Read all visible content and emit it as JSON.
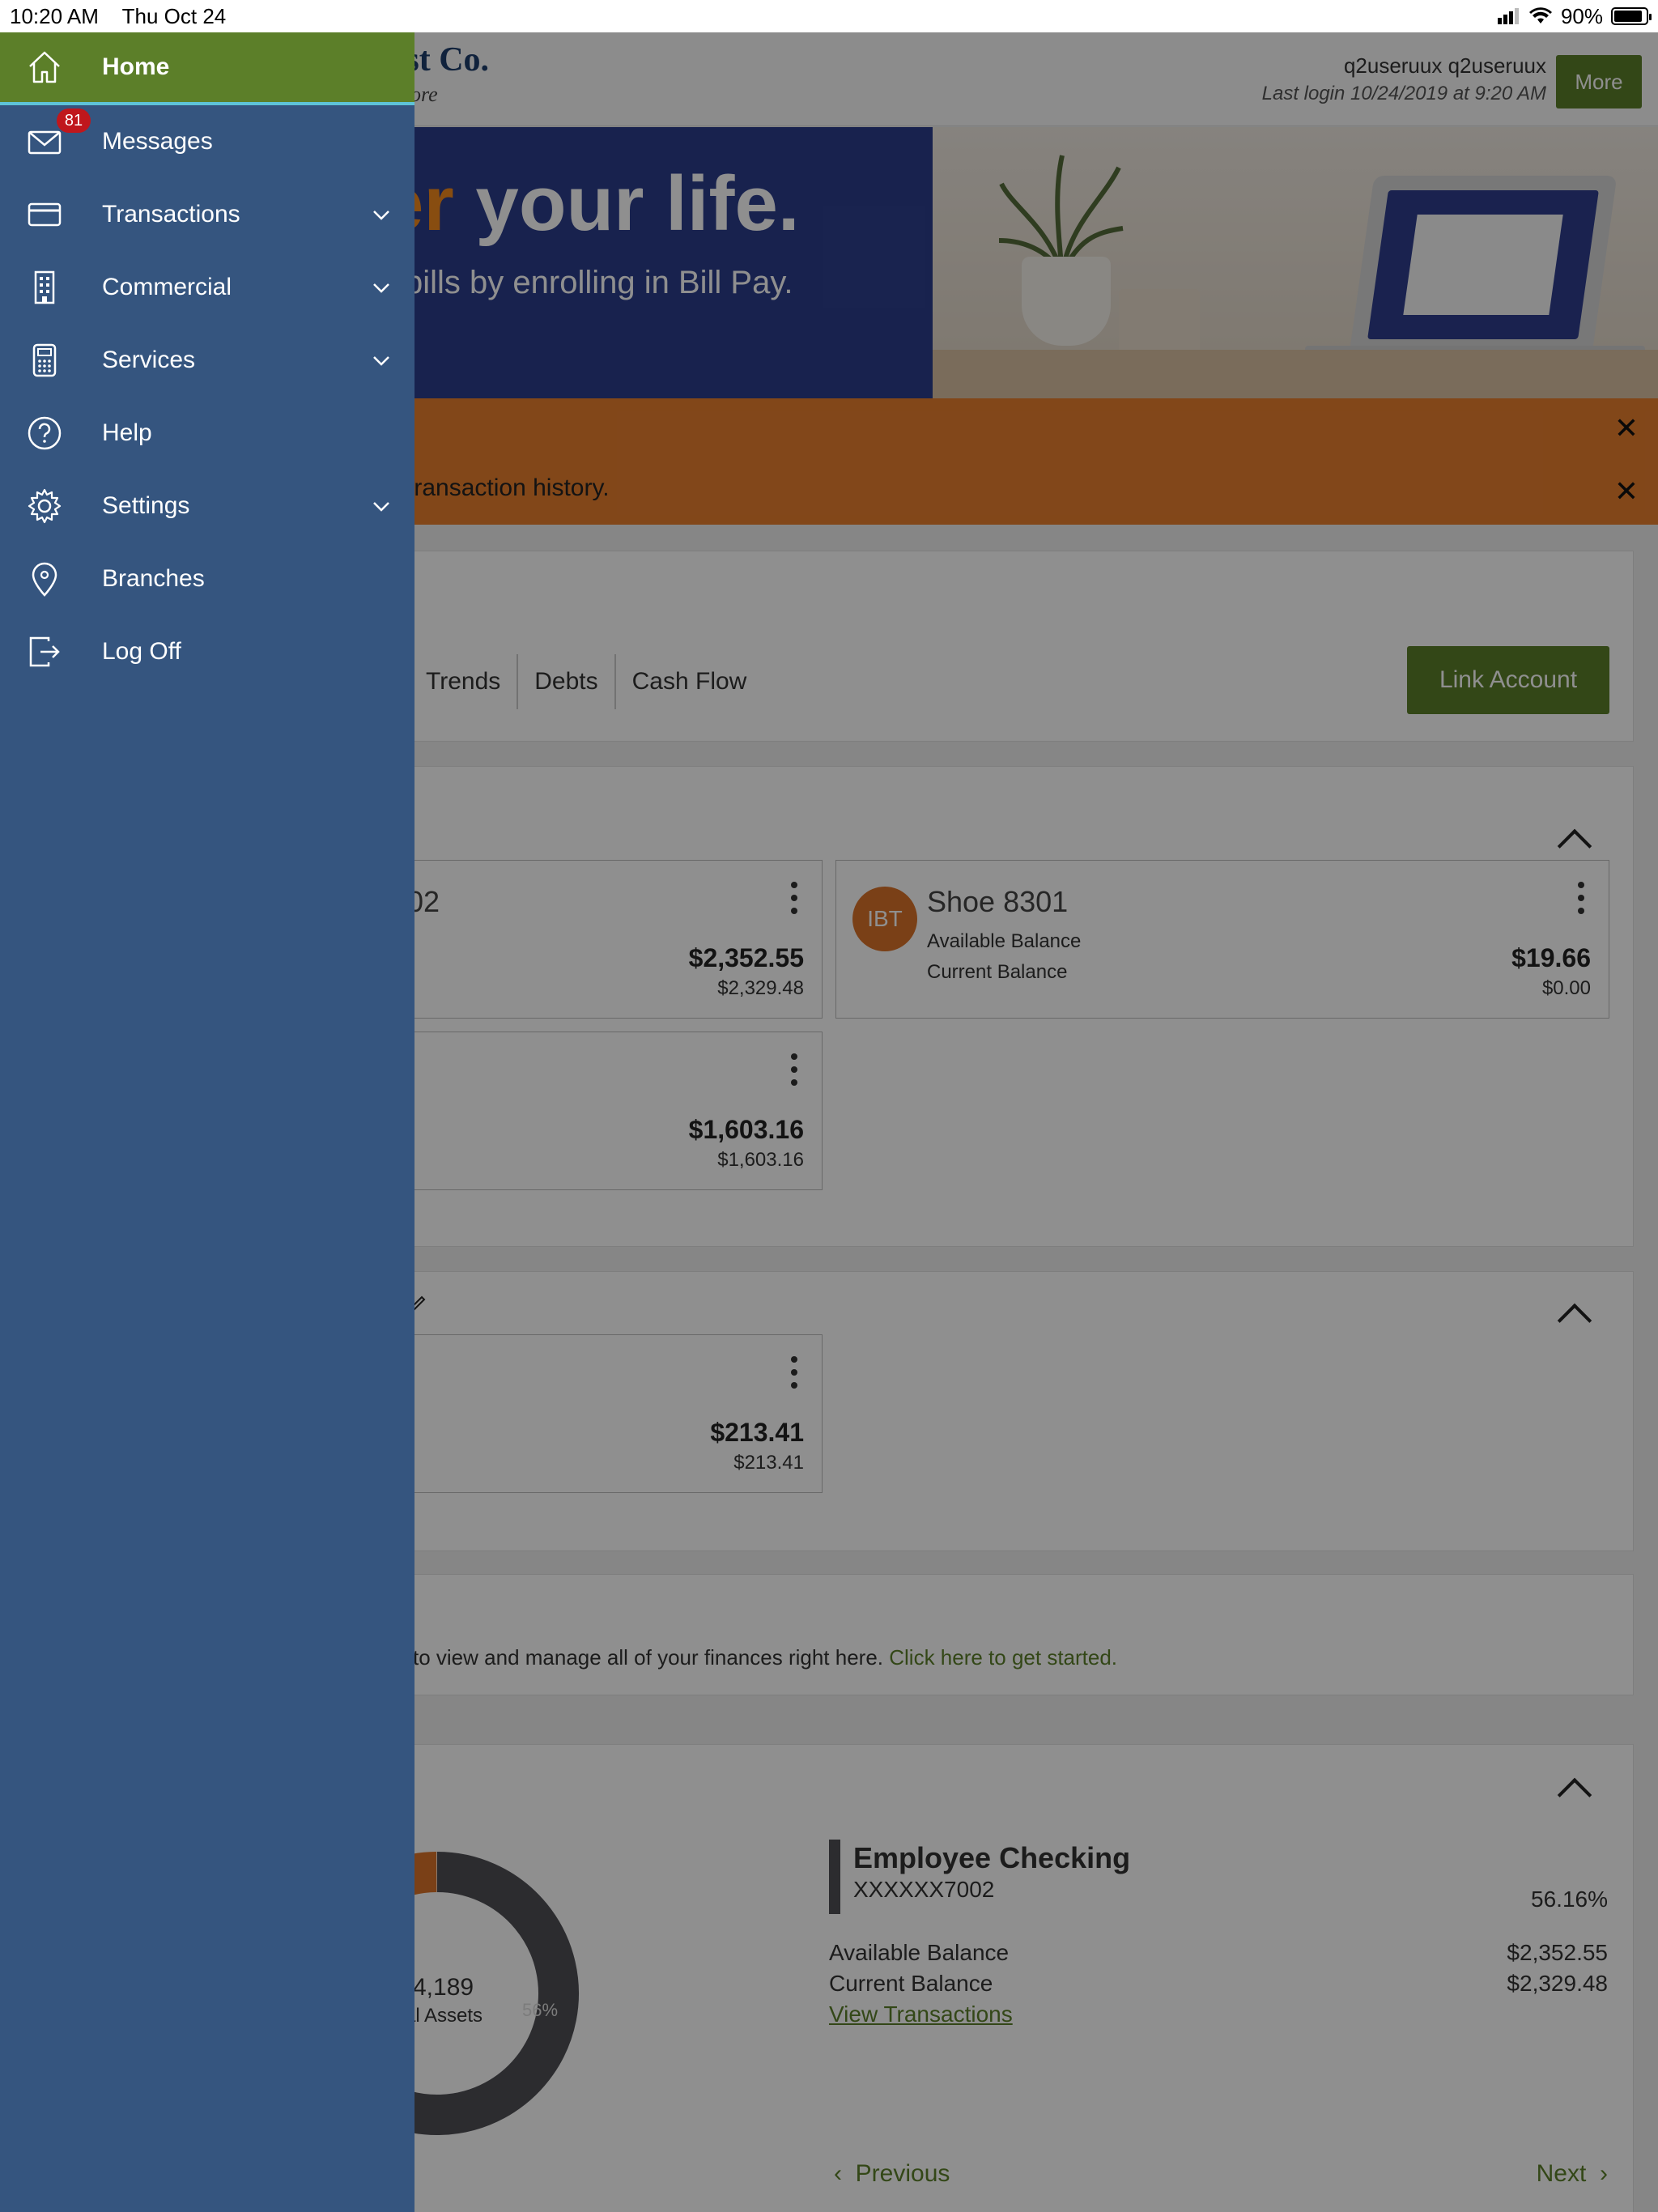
{
  "status_bar": {
    "time": "10:20 AM",
    "date": "Thu Oct 24",
    "battery": "90%",
    "battery_level": 0.9
  },
  "header": {
    "logo_text": "ust Co.",
    "logo_tagline": "dore",
    "user_name": "q2useruux q2useruux",
    "last_login": "Last login 10/24/2019 at 9:20 AM",
    "more_label": "More"
  },
  "banner": {
    "headline_accent": "er",
    "headline": " your life.",
    "subline": "bills by enrolling in Bill Pay."
  },
  "alert": {
    "text": "d transaction history."
  },
  "overview": {
    "tabs": [
      "",
      "Trends",
      "Debts",
      "Cash Flow"
    ],
    "link_account_label": "Link Account"
  },
  "accounts": {
    "card1": {
      "title": "002",
      "available": "$2,352.55",
      "current": "$2,329.48"
    },
    "card2": {
      "avatar": "IBT",
      "title": "Shoe 8301",
      "available_label": "Available Balance",
      "current_label": "Current Balance",
      "available": "$19.66",
      "current": "$0.00"
    },
    "card3": {
      "available": "$1,603.16",
      "current": "$1,603.16"
    }
  },
  "section2": {
    "card1": {
      "available": "$213.41",
      "current": "$213.41"
    }
  },
  "get_started": {
    "text": "to view and manage all of your finances right here. ",
    "link": "Click here to get started."
  },
  "assets": {
    "total": "4,189",
    "total_label": "al Assets",
    "slice_pct_label": "56%",
    "slice_share": 56.16,
    "colors": {
      "main": "#4f4f55",
      "orange": "#d9722a",
      "green": "#6a8d2e"
    },
    "account_name": "Employee Checking",
    "account_number": "XXXXXX7002",
    "account_pct": "56.16%",
    "available_label": "Available Balance",
    "available": "$2,352.55",
    "current_label": "Current Balance",
    "current": "$2,329.48",
    "view_transactions": "View Transactions",
    "previous": "Previous",
    "next": "Next"
  },
  "sidebar": {
    "items": [
      {
        "label": "Home",
        "icon": "home-icon"
      },
      {
        "label": "Messages",
        "icon": "mail-icon",
        "badge": "81"
      },
      {
        "label": "Transactions",
        "icon": "card-icon"
      },
      {
        "label": "Commercial",
        "icon": "building-icon"
      },
      {
        "label": "Services",
        "icon": "calculator-icon"
      },
      {
        "label": "Help",
        "icon": "help-icon"
      },
      {
        "label": "Settings",
        "icon": "gear-icon"
      },
      {
        "label": "Branches",
        "icon": "location-pin-icon"
      },
      {
        "label": "Log Off",
        "icon": "log-off-icon"
      }
    ]
  },
  "theme": {
    "sidebar_bg": "#35557f",
    "active_bg": "#5c7f29",
    "active_underline": "#5ec3d8",
    "alert_bg": "#e87f2e",
    "badge_bg": "#c0171c"
  }
}
